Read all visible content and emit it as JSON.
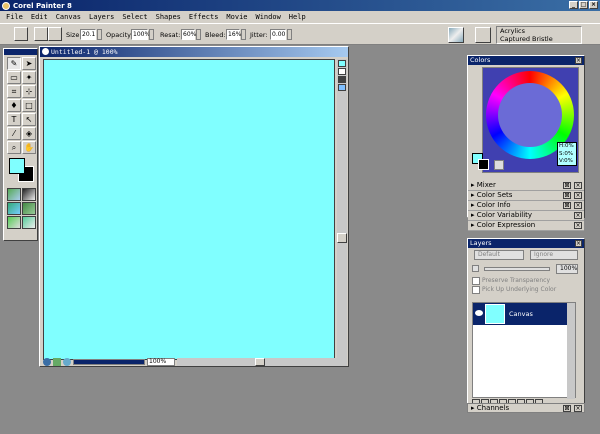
{
  "app": {
    "title": "Corel Painter 8"
  },
  "menu": [
    "File",
    "Edit",
    "Canvas",
    "Layers",
    "Select",
    "Shapes",
    "Effects",
    "Movie",
    "Window",
    "Help"
  ],
  "propbar": {
    "size_label": "Size:",
    "size_value": "20.1",
    "opacity_label": "Opacity:",
    "opacity_value": "100%",
    "resat_label": "Resat:",
    "resat_value": "60%",
    "bleed_label": "Bleed:",
    "bleed_value": "16%",
    "jitter_label": "Jitter:",
    "jitter_value": "0.00",
    "brush_category": "Acrylics",
    "brush_variant": "Captured Bristle"
  },
  "document": {
    "title": "Untitled-1 @ 100%",
    "zoom": "100%",
    "canvas_color": "#80ffff"
  },
  "colors_palette": {
    "title": "Colors",
    "hsv": {
      "h": "H:0%",
      "s": "S:0%",
      "v": "V:0%"
    }
  },
  "palette_sections": [
    "Mixer",
    "Color Sets",
    "Color Info",
    "Color Variability",
    "Color Expression"
  ],
  "layers_palette": {
    "title": "Layers",
    "composite_method": "Default",
    "composite_depth": "Ignore",
    "opacity": "100%",
    "preserve_transparency": "Preserve Transparency",
    "pick_up_color": "Pick Up Underlying Color",
    "layers": [
      "Canvas"
    ]
  },
  "channels": {
    "title": "Channels"
  }
}
